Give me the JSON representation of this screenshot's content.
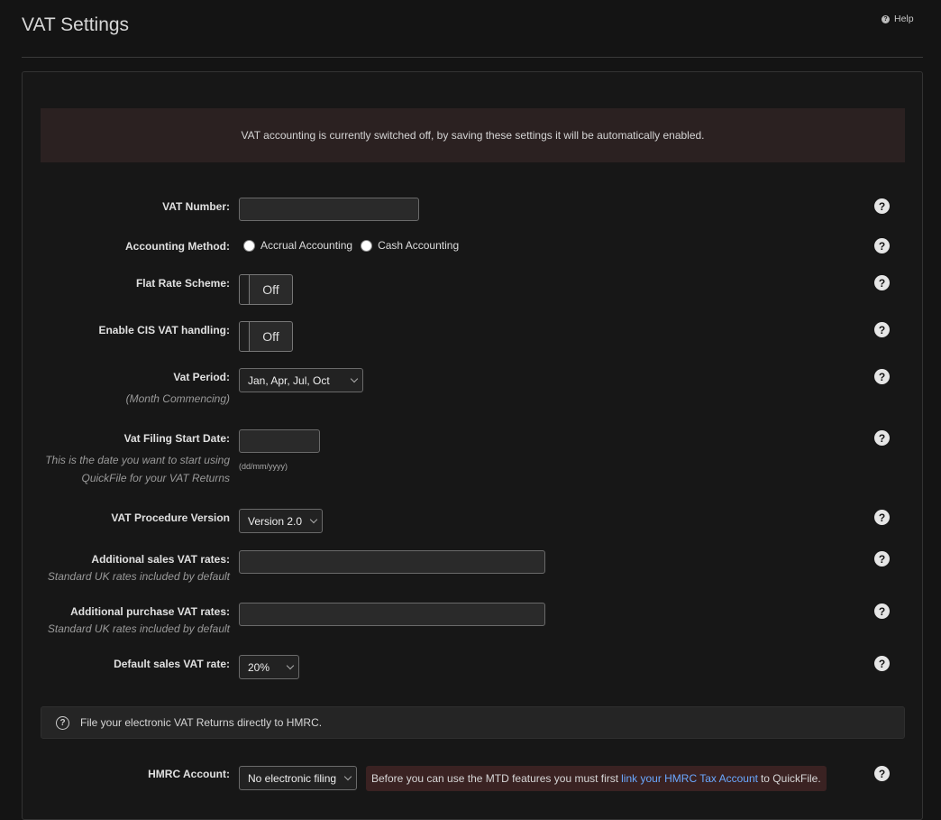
{
  "header": {
    "title": "VAT Settings",
    "help_label": "Help"
  },
  "alert": {
    "message": "VAT accounting is currently switched off, by saving these settings it will be automatically enabled."
  },
  "form": {
    "vat_number": {
      "label": "VAT Number:",
      "value": ""
    },
    "accounting_method": {
      "label": "Accounting Method:",
      "options": [
        "Accrual Accounting",
        "Cash Accounting"
      ]
    },
    "flat_rate": {
      "label": "Flat Rate Scheme:",
      "state": "Off"
    },
    "cis": {
      "label": "Enable CIS VAT handling:",
      "state": "Off"
    },
    "vat_period": {
      "label": "Vat Period:",
      "sub": "(Month Commencing)",
      "selected": "Jan, Apr, Jul, Oct"
    },
    "filing_start": {
      "label": "Vat Filing Start Date:",
      "sub": "This is the date you want to start using QuickFile for your VAT Returns",
      "value": "",
      "hint": "(dd/mm/yyyy)"
    },
    "procedure_version": {
      "label": "VAT Procedure Version",
      "selected": "Version 2.0"
    },
    "sales_rates": {
      "label": "Additional sales VAT rates:",
      "sub": "Standard UK rates included by default",
      "value": ""
    },
    "purchase_rates": {
      "label": "Additional purchase VAT rates:",
      "sub": "Standard UK rates included by default",
      "value": ""
    },
    "default_rate": {
      "label": "Default sales VAT rate:",
      "selected": "20%"
    }
  },
  "info": {
    "message": "File your electronic VAT Returns directly to HMRC."
  },
  "hmrc": {
    "label": "HMRC Account:",
    "selected": "No electronic filing",
    "note_before": "Before you can use the MTD features you must first",
    "note_link": "link your HMRC Tax Account",
    "note_after": "to QuickFile."
  }
}
